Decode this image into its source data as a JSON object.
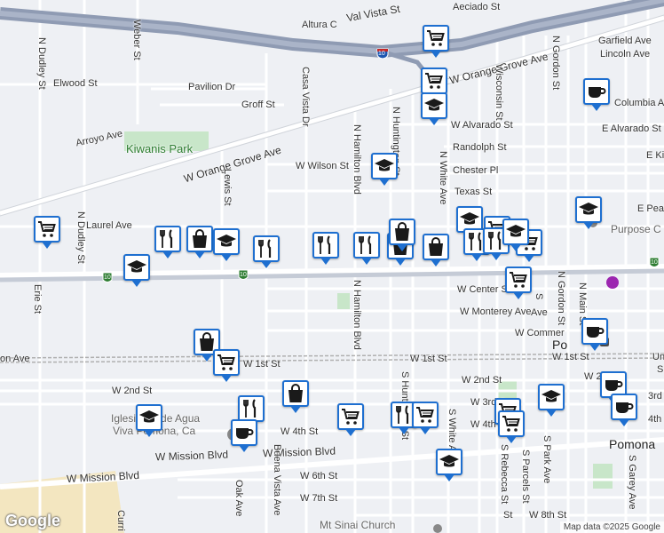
{
  "map": {
    "labels": {
      "aeciado": "Aeciado St",
      "altura": "Altura C",
      "val_vista": "Val Vista St",
      "garfield": "Garfield Ave",
      "lincoln": "Lincoln Ave",
      "weber": "Weber St",
      "dudley_n": "N Dudley St",
      "dudley_n2": "N Dudley St",
      "elwood": "Elwood St",
      "pavilion": "Pavilion Dr",
      "casa_vista": "Casa Vista Dr",
      "orange_grove_e": "W Orange Grove Ave",
      "wisconsin": "Wisconsin St",
      "gordon_n_top": "N Gordon St",
      "groff": "Groff St",
      "columbia": "Columbia Ave",
      "alvarado_w": "W Alvarado St",
      "alvarado_e": "E Alvarado St",
      "arroyo": "Arroyo Ave",
      "kiwanis": "Kiwanis Park",
      "orange_grove_w": "W Orange Grove Ave",
      "randolph": "Randolph St",
      "hamilton_n": "N Hamilton Blvd",
      "huntington_n": "N Huntington St",
      "wilson": "W Wilson St",
      "chester": "Chester Pl",
      "white_n": "N White Ave",
      "texas": "Texas St",
      "lewis": "Lewis St",
      "laurel": "Laurel Ave",
      "e_king": "E Kin",
      "e_pearl": "E Pear",
      "purpose": "Purpose C",
      "erie": "Erie St",
      "center": "W Center St",
      "monterey": "W Monterey Ave",
      "hamilton_n2": "N Hamilton Blvd",
      "gordon_n": "N Gordon St",
      "main_n": "N Main St",
      "commercial": "W Commer",
      "pomona_top": "Po",
      "first_w": "W 1st St",
      "first_w2": "W 1st St",
      "first_w3": "W 1st St",
      "union": "Un",
      "union2": "S",
      "on_ave": "on Ave",
      "second_w": "W 2nd St",
      "second_w2": "W 2nd St",
      "second_w3": "W 2",
      "third_w": "W 3rd S",
      "third_e": "3rd",
      "fourth_w": "W 4th St",
      "fourth_w2": "W 4th S",
      "fourth_e": "4th",
      "church1": "Iglesia Pe de Agua",
      "church2": "Viva Pomona, Ca",
      "mission_w": "W Mission Blvd",
      "mission_w2": "W Mission Blvd",
      "mission_w3": "W Mission Blvd",
      "pomona": "Pomona",
      "huntington_s": "S Huntington St",
      "white_s": "S White Ave",
      "rebecca": "S Rebecca St",
      "parcels": "S Parcels St",
      "park_s": "S Park Ave",
      "garey": "S Garey Ave",
      "sixth": "W 6th St",
      "seventh": "W 7th St",
      "eighth": "W 8th St",
      "st_s": "St",
      "oak": "Oak Ave",
      "buena_vista": "Buena Vista Ave",
      "curri": "Curri",
      "mt_sinai": "Mt Sinai Church",
      "s_ave": "S",
      "ave_short": "Ave",
      "i10_a": "10",
      "i10_b": "10",
      "i10_c": "10",
      "i10_d": "10"
    },
    "branding": "Google",
    "attribution": "Map data ©2025 Google",
    "colors": {
      "land": "#eef0f4",
      "road": "#ffffff",
      "freeway": "#8f9bb3",
      "park": "#c8e6c9",
      "rail": "#b0b0b0",
      "pin_border": "#1e6fd0",
      "icon": "#1a1a1a"
    },
    "markers": [
      {
        "type": "grocery",
        "icon": "cart-icon"
      },
      {
        "type": "grocery",
        "icon": "cart-icon"
      },
      {
        "type": "school",
        "icon": "graduation-cap-icon"
      },
      {
        "type": "cafe",
        "icon": "coffee-cup-icon"
      },
      {
        "type": "school",
        "icon": "graduation-cap-icon"
      },
      {
        "type": "grocery",
        "icon": "cart-icon"
      },
      {
        "type": "restaurant",
        "icon": "fork-knife-icon"
      },
      {
        "type": "shopping",
        "icon": "shopping-bag-icon"
      },
      {
        "type": "school",
        "icon": "graduation-cap-icon"
      },
      {
        "type": "restaurant",
        "icon": "fork-knife-icon"
      },
      {
        "type": "school",
        "icon": "graduation-cap-icon"
      },
      {
        "type": "restaurant",
        "icon": "fork-knife-icon"
      },
      {
        "type": "restaurant",
        "icon": "fork-knife-icon"
      },
      {
        "type": "shopping",
        "icon": "shopping-bag-icon"
      },
      {
        "type": "shopping",
        "icon": "shopping-bag-icon"
      },
      {
        "type": "school",
        "icon": "graduation-cap-icon"
      },
      {
        "type": "restaurant",
        "icon": "fork-knife-icon"
      },
      {
        "type": "shopping",
        "icon": "shopping-bag-icon"
      },
      {
        "type": "grocery",
        "icon": "cart-icon"
      },
      {
        "type": "school",
        "icon": "graduation-cap-icon"
      },
      {
        "type": "grocery",
        "icon": "cart-icon"
      },
      {
        "type": "cafe",
        "icon": "coffee-cup-icon"
      },
      {
        "type": "shopping",
        "icon": "shopping-bag-icon"
      },
      {
        "type": "grocery",
        "icon": "cart-icon"
      },
      {
        "type": "shopping",
        "icon": "shopping-bag-icon"
      },
      {
        "type": "restaurant",
        "icon": "fork-knife-icon"
      },
      {
        "type": "school",
        "icon": "graduation-cap-icon"
      },
      {
        "type": "grocery",
        "icon": "cart-icon"
      },
      {
        "type": "restaurant",
        "icon": "fork-knife-icon"
      },
      {
        "type": "grocery",
        "icon": "cart-icon"
      },
      {
        "type": "school",
        "icon": "graduation-cap-icon"
      },
      {
        "type": "cafe",
        "icon": "coffee-cup-icon"
      },
      {
        "type": "cafe",
        "icon": "coffee-cup-icon"
      },
      {
        "type": "cafe",
        "icon": "coffee-cup-icon"
      },
      {
        "type": "restaurant",
        "icon": "fork-knife-icon"
      },
      {
        "type": "grocery",
        "icon": "cart-icon"
      },
      {
        "type": "grocery",
        "icon": "cart-icon"
      },
      {
        "type": "grocery",
        "icon": "cart-icon"
      },
      {
        "type": "school",
        "icon": "graduation-cap-icon"
      },
      {
        "type": "school",
        "icon": "graduation-cap-icon"
      }
    ]
  }
}
